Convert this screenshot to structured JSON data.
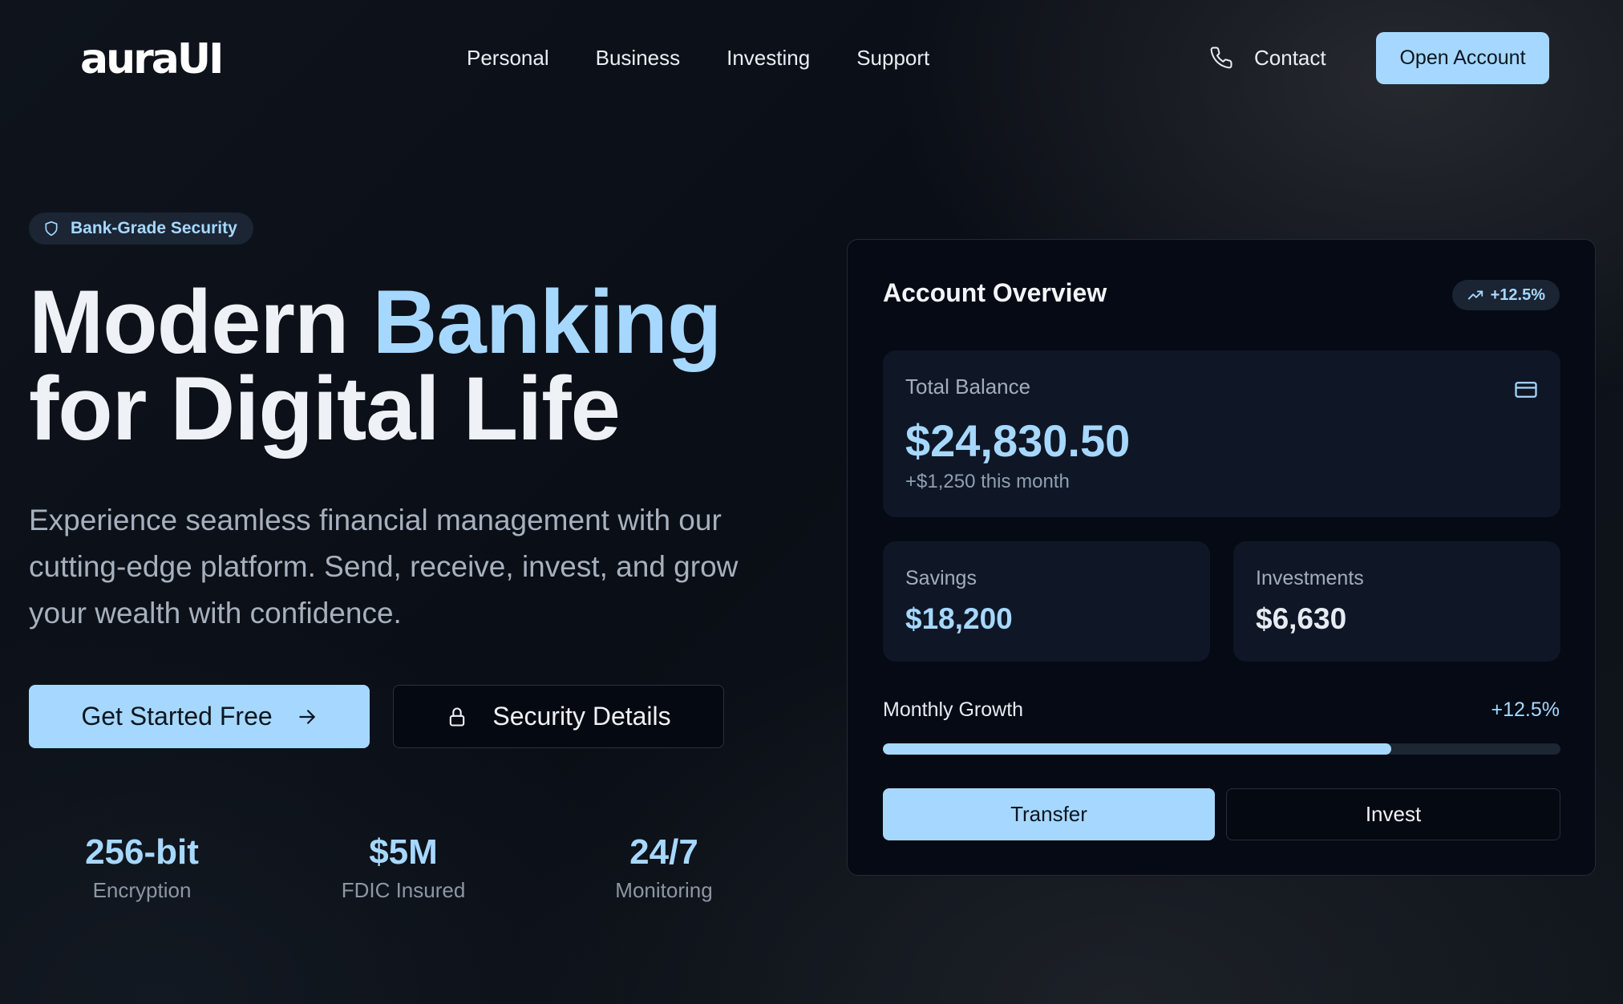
{
  "nav": {
    "logo": "auraUI",
    "links": [
      "Personal",
      "Business",
      "Investing",
      "Support"
    ],
    "contact_label": "Contact",
    "contact_icon": "phone-icon",
    "open_account_label": "Open Account"
  },
  "hero": {
    "badge": "Bank-Grade Security",
    "badge_icon": "shield-icon",
    "headline_part1": "Modern ",
    "headline_accent": "Banking",
    "headline_part2": "for Digital Life",
    "subtext": "Experience seamless financial management with our cutting-edge platform. Send, receive, invest, and grow your wealth with confidence.",
    "primary_cta": "Get Started Free",
    "primary_cta_icon": "arrow-right-icon",
    "secondary_cta": "Security Details",
    "secondary_cta_icon": "lock-icon",
    "stats": [
      {
        "value": "256-bit",
        "label": "Encryption"
      },
      {
        "value": "$5M",
        "label": "FDIC Insured"
      },
      {
        "value": "24/7",
        "label": "Monitoring"
      }
    ]
  },
  "card": {
    "title": "Account Overview",
    "growth_badge": "+12.5%",
    "growth_badge_icon": "trending-up-icon",
    "total_balance_label": "Total Balance",
    "total_balance_icon": "credit-card-icon",
    "total_balance": "$24,830.50",
    "balance_change": "+$1,250 this month",
    "savings_label": "Savings",
    "savings_value": "$18,200",
    "investments_label": "Investments",
    "investments_value": "$6,630",
    "monthly_growth_label": "Monthly Growth",
    "monthly_growth_value": "+12.5%",
    "monthly_growth_progress": 0.75,
    "transfer_label": "Transfer",
    "invest_label": "Invest"
  },
  "colors": {
    "accent": "#a6d8ff",
    "background": "#0b0f17",
    "card_background": "#050a14",
    "panel_background": "#0f1726"
  }
}
